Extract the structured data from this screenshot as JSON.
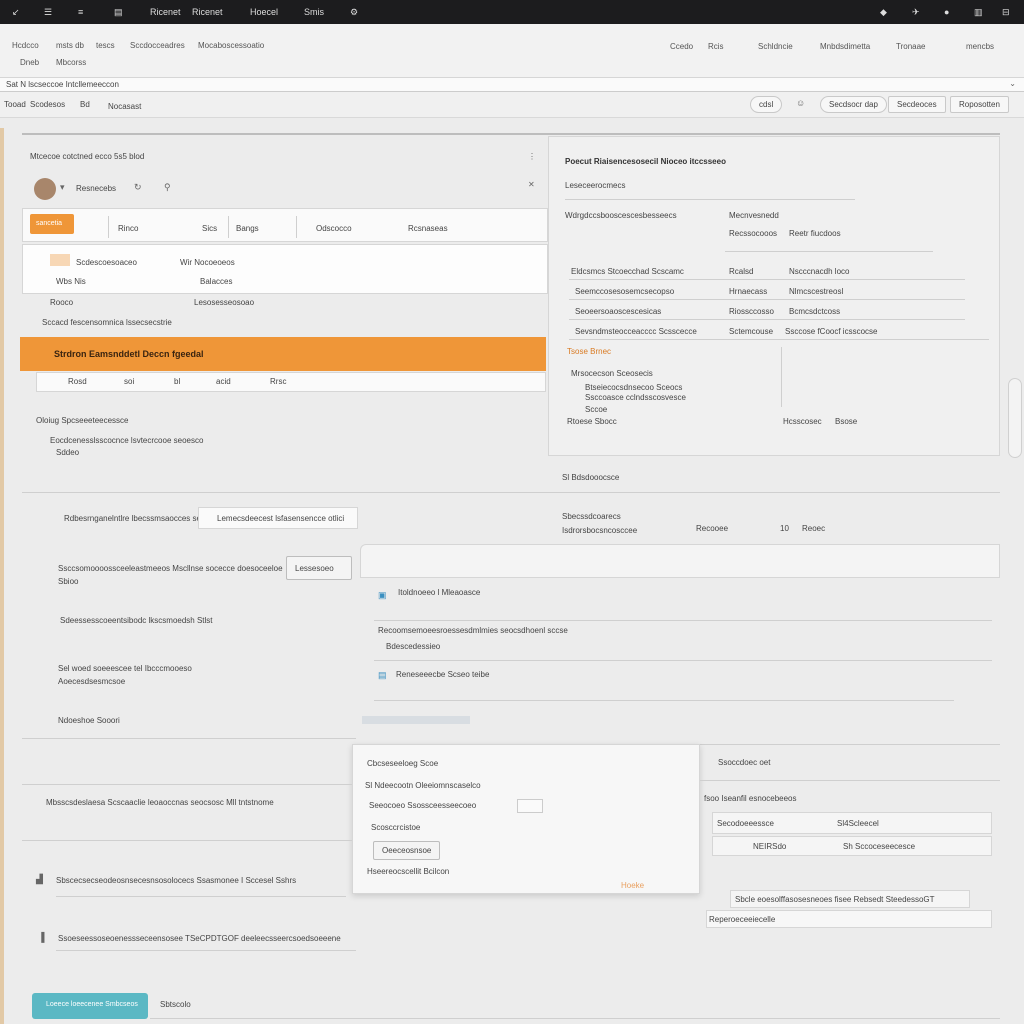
{
  "topbar": {
    "items": [
      "Ricenet",
      "Hoecel",
      "Smis"
    ]
  },
  "toolbar": {
    "left": [
      "Hcdcco",
      "msts db",
      "tescs",
      "Sccdocceadres",
      "Mocaboscessoatio"
    ],
    "left2": [
      "Dneb",
      "Mbcorss"
    ],
    "right": [
      "Ccedo",
      "Rcis",
      "Schldncie",
      "Mnbdsdimetta",
      "Tronaae",
      "mencbs"
    ]
  },
  "addressbar": {
    "text": "Sat N lscseccoe Intcllemeeccon"
  },
  "tabbar": {
    "left": [
      "Tooad",
      "Scodesos",
      "Bd",
      "Nocasast"
    ],
    "right": [
      "cdsl",
      "Secdsocr dap",
      "Secdeoces",
      "Roposotten"
    ]
  },
  "leftpanel": {
    "title": "Mtcecoe cotctned ecco 5s5 blod",
    "user": "Resnecebs",
    "cols": [
      "Rinco",
      "Sics",
      "Bangs",
      "Odscocco",
      "Rcsnaseas"
    ],
    "tab_btn": "sancetia",
    "row1": [
      "Scdescoesoaceo",
      "Wir Nocoeoeos"
    ],
    "row2": [
      "Wbs Nis",
      "Balacces"
    ],
    "row3": "Rooco",
    "row3b": "Lesosesseosoao",
    "row4": "Sccacd fescensomnica  lssecsecstrie",
    "banner": "Strdron Eamsnddetl Deccn fgeedal",
    "sub": [
      "Rosd",
      "soi",
      "bl",
      "acid",
      "Rrsc"
    ],
    "note1": "Oloiug  Spcseeeteecessce",
    "note2": "Eocdcenesslsscocnce lsvtecrcooe seoesco",
    "note3": "Sddeo"
  },
  "rightpanel": {
    "title": "Poecut Riaisencesosecil Nioceo itccsseeo",
    "sub": "Leseceerocmecs",
    "r1": [
      "Wdrgdccsbooscescesbesseecs",
      "Mecnvesnedd"
    ],
    "r1b": [
      "Recssocooos",
      "Reetr fiucdoos"
    ],
    "grid": [
      [
        "Eldcsmcs Stcoecchad Scscamc",
        "Rcalsd",
        "Nscccnacdh loco"
      ],
      [
        "Seemccosesosemcsecopso",
        "Hrnaecass",
        "Nlmcscestreosl"
      ],
      [
        "Seoeersoaoscescesicas",
        "Riossccosso",
        "Bcmcsdctcoss"
      ],
      [
        "Sevsndmsteocceacccc Scsscecce",
        "Sctemcouse",
        "Ssccose fCoocf icsscocse"
      ]
    ],
    "orange_lbl": "Tsose Brnec",
    "small1": "Mrsocecson Sceosecis",
    "small2": "Btseiecocsdnsecoo Sceocs",
    "small3": "Ssccoasce cclndsscosvesce",
    "small4": "Sccoe",
    "foot_left": "Rtoese Sbocc",
    "foot_right": "Hcsscosec",
    "foot_right2": "Bsose",
    "footer": "Sl Bdsdooocsce"
  },
  "midsection": {
    "row1_lbl": "Rdbesrnganelntlre lbecssmsaocces seeg",
    "row1_input": "Lemecsdeecest lsfasensencce otlici",
    "right_title": "Sbecssdcoarecs",
    "right_sub": "Isdrorsbocsncosccee",
    "right_vals": [
      "Recooee",
      "10",
      "Reoec"
    ],
    "row2_lbl": "Ssccsomoooossceeleastmeeos  Mscllnse socecce  doesoceeloe",
    "row2_sub": "Sbioo",
    "row2_btn": "Lessesoeo",
    "card_title": "Itoldnoeeo l Mleaoasce",
    "card_line": "Recoomsemoeesroessesdmlmies seocsdhoenl sccse",
    "card_line2": "Bdescedessieo",
    "row3_lbl": "Sdeessesscoeentsibodc  lkscsmoedsh Stlst",
    "row4_lbl": "Sel woed soeeescee  tel  Ibcccmooeso",
    "row4_sub": "Aoecesdsesmcsoe",
    "file": "Reneseeecbe Scseo teibe",
    "row5_lbl": "Ndoeshoe Sooori"
  },
  "popup": {
    "title": "Cbcseseeloeg Scoe",
    "l1": "Sl Ndeecootn Oleeiomnscaselco",
    "l2": "Seeocoeo Ssossceesseecoeo",
    "l3": "Scosccrcistoe",
    "btn": "Oeeceosnsoe",
    "l4": "Hseereocscellit Bcilcon",
    "orange": "Hoeke"
  },
  "lowright": {
    "title": "Ssoccdoec oet",
    "l1": "fsoo Iseanfil esnocebeeos",
    "row1": [
      "Secodoeeessce",
      "Sl4Scleecel"
    ],
    "row2": [
      "NEIRSdo",
      "Sh Sccoceseecesce"
    ],
    "l2": "Sbcle eoesolffasosesneoes  fisee Rebsedt SteedessoGT",
    "l3": "Reperoeceeiecelle"
  },
  "lowleft": {
    "r1": "Mbsscsdeslaesa Scscaaclie leoaoccnas seocsosc Mll tntstnome",
    "r2": "Sbscecsecseodeosnsecesnsosolocecs  Ssasmonee I  Sccesel Sshrs",
    "r3": "Ssoeseessoseoenessseceensosee TSeCPDTGOF  deeleecsseercsoedsoeeene",
    "btn": "Loeece loeecenee Smbcseos",
    "btn_right": "Sbtscolo"
  },
  "colors": {
    "accent": "#ef9638",
    "teal": "#5bb8c4"
  }
}
